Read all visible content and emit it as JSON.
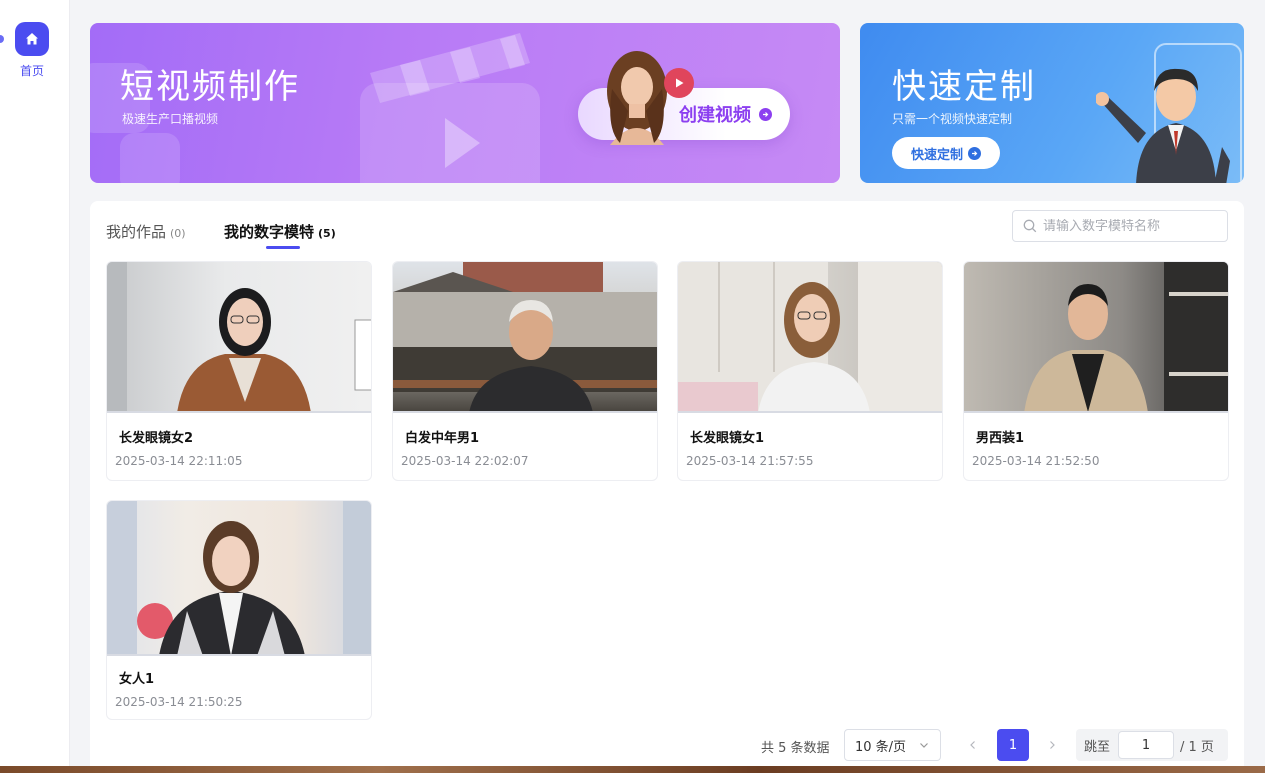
{
  "sidebar": {
    "home_label": "首页"
  },
  "banners": {
    "short_video": {
      "title": "短视频制作",
      "subtitle": "极速生产口播视频",
      "button": "创建视频"
    },
    "custom": {
      "title": "快速定制",
      "subtitle": "只需一个视频快速定制",
      "button": "快速定制"
    }
  },
  "tabs": [
    {
      "label": "我的作品",
      "count": "(0)"
    },
    {
      "label": "我的数字模特",
      "count": "(5)"
    }
  ],
  "search": {
    "placeholder": "请输入数字模特名称"
  },
  "models": [
    {
      "name": "长发眼镜女2",
      "time": "2025-03-14 22:11:05"
    },
    {
      "name": "白发中年男1",
      "time": "2025-03-14 22:02:07"
    },
    {
      "name": "长发眼镜女1",
      "time": "2025-03-14 21:57:55"
    },
    {
      "name": "男西装1",
      "time": "2025-03-14 21:52:50"
    },
    {
      "name": "女人1",
      "time": "2025-03-14 21:50:25"
    }
  ],
  "pagination": {
    "total_text": "共 5 条数据",
    "page_size": "10 条/页",
    "current_page": "1",
    "jump_label": "跳至",
    "jump_value": "1",
    "total_pages": "/ 1 页"
  },
  "colors": {
    "accent": "#4b4cf0",
    "banner_purple": "#b77af6",
    "banner_blue": "#4a98f3"
  }
}
